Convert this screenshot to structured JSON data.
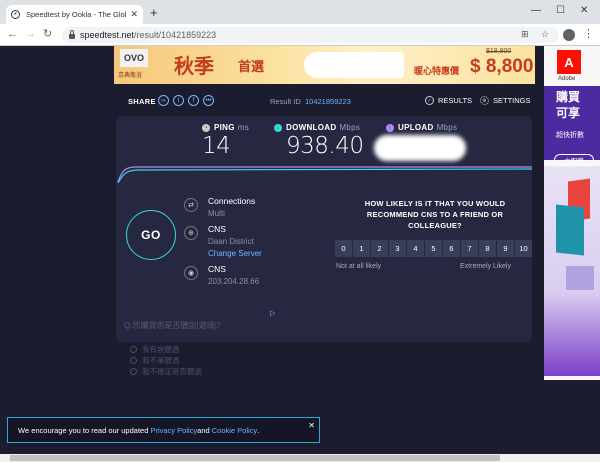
{
  "browser": {
    "tab_title": "Speedtest by Ookla - The Glob",
    "url_host": "speedtest.net",
    "url_path": "/result/10421859223"
  },
  "ad_banner": {
    "brand": "OVO",
    "brand_sub": "京典衛浴",
    "title": "秋季",
    "title2": "首選",
    "offer": "暖心特惠價",
    "old_price": "$18,800",
    "price": "$ 8,800"
  },
  "share": {
    "label": "SHARE",
    "result_label": "Result ID",
    "result_id": "10421859223",
    "results_label": "RESULTS",
    "settings_label": "SETTINGS"
  },
  "metrics": {
    "ping": {
      "label": "PING",
      "unit": "ms",
      "value": "14"
    },
    "download": {
      "label": "DOWNLOAD",
      "unit": "Mbps",
      "value": "938.40"
    },
    "upload": {
      "label": "UPLOAD",
      "unit": "Mbps",
      "value": ""
    }
  },
  "go_label": "GO",
  "connection": {
    "title": "Connections",
    "mode": "Multi",
    "host_name": "CNS",
    "host_location": "Daan District",
    "change_server": "Change Server",
    "isp_name": "CNS",
    "ip": "203.204.28.66"
  },
  "survey": {
    "question": "HOW LIKELY IS IT THAT YOU WOULD RECOMMEND CNS TO A FRIEND OR COLLEAGUE?",
    "scale": [
      "0",
      "1",
      "2",
      "3",
      "4",
      "5",
      "6",
      "7",
      "8",
      "9",
      "10"
    ],
    "low_label": "Not at all likely",
    "high_label": "Extremely Likely"
  },
  "poll": {
    "question": "Q:您購買您是否聽說[選綠]？",
    "options": [
      "我有說聽過",
      "我不單聽過",
      "我不確定是否聽過"
    ]
  },
  "side_ad": {
    "brand": "Adobe",
    "promo_line1": "購買",
    "promo_line2": "可享",
    "promo_sub": "超快折數",
    "cta": "立即購"
  },
  "cookie": {
    "prefix": "We encourage you to read our updated ",
    "privacy": "Privacy Policy",
    "and": " and ",
    "cookie_policy": "Cookie Policy",
    "suffix": "."
  },
  "colors": {
    "background": "#1b1c2e",
    "card": "#262841",
    "accent_link": "#6fb6ff",
    "go_ring": "#3ad8d8",
    "download_line": "#3ad8d8",
    "upload_line": "#b682ff"
  }
}
